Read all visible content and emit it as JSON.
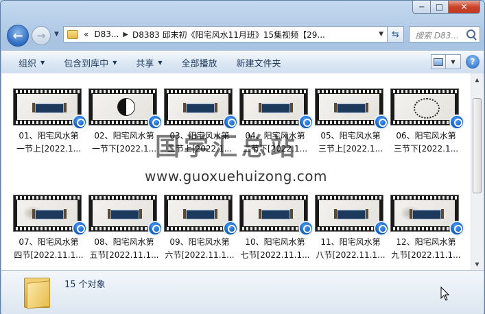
{
  "window": {
    "controls": {
      "minimize": "─",
      "maximize": "□",
      "close": "✕"
    }
  },
  "nav": {
    "back_icon": "arrow-left-icon",
    "forward_icon": "arrow-right-icon",
    "breadcrumb": [
      "«",
      "D83...",
      "D8383 邱末初《阳宅风水11月班》15集视频【29..."
    ],
    "search_placeholder": "搜索 D83..."
  },
  "toolbar": {
    "items": [
      "组织",
      "包含到库中",
      "共享",
      "全部播放",
      "新建文件夹"
    ]
  },
  "files": [
    {
      "line1": "01、阳宅风水第",
      "line2": "一节上[2022.1..."
    },
    {
      "line1": "02、阳宅风水第",
      "line2": "一节下[2022.1..."
    },
    {
      "line1": "03、阳宅风水第",
      "line2": "二节上[2022.1..."
    },
    {
      "line1": "04、阳宅风水第",
      "line2": "二节下[2022.1..."
    },
    {
      "line1": "05、阳宅风水第",
      "line2": "三节上[2022.1..."
    },
    {
      "line1": "06、阳宅风水第",
      "line2": "三节下[2022.1..."
    },
    {
      "line1": "07、阳宅风水第",
      "line2": "四节[2022.11.1..."
    },
    {
      "line1": "08、阳宅风水第",
      "line2": "五节[2022.11.1..."
    },
    {
      "line1": "09、阳宅风水第",
      "line2": "六节[2022.11.1..."
    },
    {
      "line1": "10、阳宅风水第",
      "line2": "七节[2022.11.1..."
    },
    {
      "line1": "11、阳宅风水第",
      "line2": "八节[2022.11.1..."
    },
    {
      "line1": "12、阳宅风水第",
      "line2": "九节[2022.11.1..."
    }
  ],
  "watermark": {
    "title": "国学汇总站",
    "url": "www.guoxuehuizong.com"
  },
  "status": {
    "count": "15 个对象"
  }
}
